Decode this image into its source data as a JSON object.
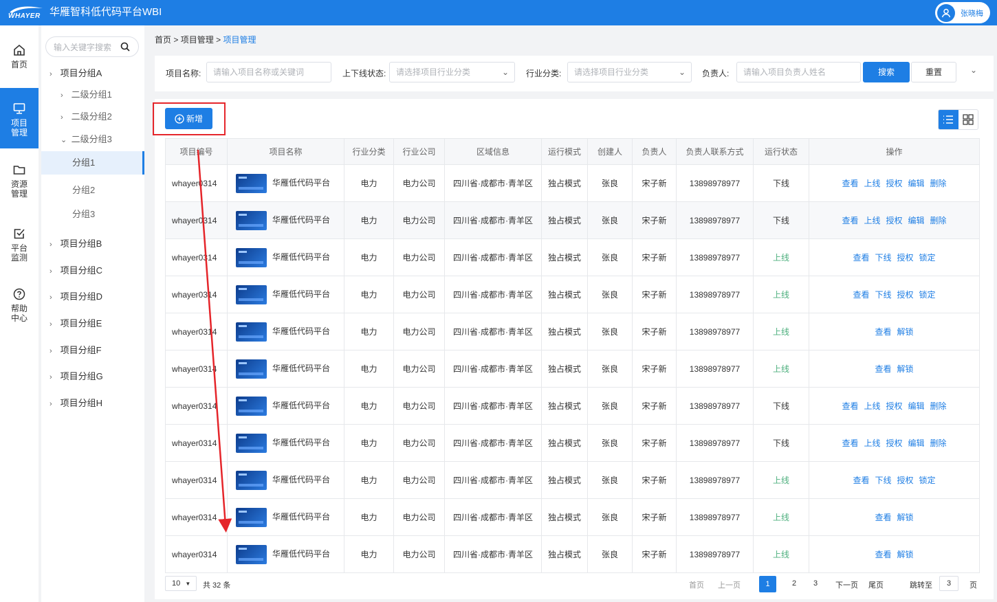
{
  "header": {
    "logo_text": "WHAYER",
    "title": "华雁智科低代码平台WBI",
    "user_name": "张晓梅"
  },
  "rail": [
    {
      "label": "首页",
      "icon": "home-icon"
    },
    {
      "label": "项目\n管理",
      "icon": "monitor-icon",
      "active": true
    },
    {
      "label": "资源\n管理",
      "icon": "folder-icon"
    },
    {
      "label": "平台\n监测",
      "icon": "check-square-icon"
    },
    {
      "label": "帮助\n中心",
      "icon": "help-circle-icon"
    }
  ],
  "tree": {
    "search_placeholder": "输入关键字搜索",
    "nodes": [
      "项目分组A",
      "二级分组1",
      "二级分组2",
      "二级分组3",
      "分组1",
      "分组2",
      "分组3",
      "项目分组B",
      "项目分组C",
      "项目分组D",
      "项目分组E",
      "项目分组F",
      "项目分组G",
      "项目分组H"
    ]
  },
  "breadcrumb": {
    "home": "首页",
    "sep": ">",
    "level1": "项目管理",
    "current": "项目管理"
  },
  "filters": {
    "name_label": "项目名称:",
    "name_placeholder": "请输入项目名称或关键词",
    "status_label": "上下线状态:",
    "status_placeholder": "请选择项目行业分类",
    "industry_label": "行业分类:",
    "industry_placeholder": "请选择项目行业分类",
    "owner_label": "负责人:",
    "owner_placeholder": "请输入项目负责人姓名",
    "search_button": "搜索",
    "reset_button": "重置"
  },
  "toolbar": {
    "add_button": "新增"
  },
  "table": {
    "headers": [
      "项目编号",
      "项目名称",
      "行业分类",
      "行业公司",
      "区域信息",
      "运行模式",
      "创建人",
      "负责人",
      "负责人联系方式",
      "运行状态",
      "操作"
    ],
    "rows": [
      {
        "code": "whayer0314",
        "name": "华雁低代码平台",
        "industry": "电力",
        "company": "电力公司",
        "region": "四川省·成都市·青羊区",
        "mode": "独占模式",
        "creator": "张良",
        "owner": "宋子新",
        "phone": "13898978977",
        "status": "下线",
        "online": false,
        "ops": [
          "查看",
          "上线",
          "授权",
          "编辑",
          "删除"
        ]
      },
      {
        "code": "whayer0314",
        "name": "华雁低代码平台",
        "industry": "电力",
        "company": "电力公司",
        "region": "四川省·成都市·青羊区",
        "mode": "独占模式",
        "creator": "张良",
        "owner": "宋子新",
        "phone": "13898978977",
        "status": "下线",
        "online": false,
        "ops": [
          "查看",
          "上线",
          "授权",
          "编辑",
          "删除"
        ]
      },
      {
        "code": "whayer0314",
        "name": "华雁低代码平台",
        "industry": "电力",
        "company": "电力公司",
        "region": "四川省·成都市·青羊区",
        "mode": "独占模式",
        "creator": "张良",
        "owner": "宋子新",
        "phone": "13898978977",
        "status": "上线",
        "online": true,
        "ops": [
          "查看",
          "下线",
          "授权",
          "锁定"
        ]
      },
      {
        "code": "whayer0314",
        "name": "华雁低代码平台",
        "industry": "电力",
        "company": "电力公司",
        "region": "四川省·成都市·青羊区",
        "mode": "独占模式",
        "creator": "张良",
        "owner": "宋子新",
        "phone": "13898978977",
        "status": "上线",
        "online": true,
        "ops": [
          "查看",
          "下线",
          "授权",
          "锁定"
        ]
      },
      {
        "code": "whayer0314",
        "name": "华雁低代码平台",
        "industry": "电力",
        "company": "电力公司",
        "region": "四川省·成都市·青羊区",
        "mode": "独占模式",
        "creator": "张良",
        "owner": "宋子新",
        "phone": "13898978977",
        "status": "上线",
        "online": true,
        "ops": [
          "查看",
          "解锁"
        ]
      },
      {
        "code": "whayer0314",
        "name": "华雁低代码平台",
        "industry": "电力",
        "company": "电力公司",
        "region": "四川省·成都市·青羊区",
        "mode": "独占模式",
        "creator": "张良",
        "owner": "宋子新",
        "phone": "13898978977",
        "status": "上线",
        "online": true,
        "ops": [
          "查看",
          "解锁"
        ]
      },
      {
        "code": "whayer0314",
        "name": "华雁低代码平台",
        "industry": "电力",
        "company": "电力公司",
        "region": "四川省·成都市·青羊区",
        "mode": "独占模式",
        "creator": "张良",
        "owner": "宋子新",
        "phone": "13898978977",
        "status": "下线",
        "online": false,
        "ops": [
          "查看",
          "上线",
          "授权",
          "编辑",
          "删除"
        ]
      },
      {
        "code": "whayer0314",
        "name": "华雁低代码平台",
        "industry": "电力",
        "company": "电力公司",
        "region": "四川省·成都市·青羊区",
        "mode": "独占模式",
        "creator": "张良",
        "owner": "宋子新",
        "phone": "13898978977",
        "status": "下线",
        "online": false,
        "ops": [
          "查看",
          "上线",
          "授权",
          "编辑",
          "删除"
        ]
      },
      {
        "code": "whayer0314",
        "name": "华雁低代码平台",
        "industry": "电力",
        "company": "电力公司",
        "region": "四川省·成都市·青羊区",
        "mode": "独占模式",
        "creator": "张良",
        "owner": "宋子新",
        "phone": "13898978977",
        "status": "上线",
        "online": true,
        "ops": [
          "查看",
          "下线",
          "授权",
          "锁定"
        ]
      },
      {
        "code": "whayer0314",
        "name": "华雁低代码平台",
        "industry": "电力",
        "company": "电力公司",
        "region": "四川省·成都市·青羊区",
        "mode": "独占模式",
        "creator": "张良",
        "owner": "宋子新",
        "phone": "13898978977",
        "status": "上线",
        "online": true,
        "ops": [
          "查看",
          "解锁"
        ]
      },
      {
        "code": "whayer0314",
        "name": "华雁低代码平台",
        "industry": "电力",
        "company": "电力公司",
        "region": "四川省·成都市·青羊区",
        "mode": "独占模式",
        "creator": "张良",
        "owner": "宋子新",
        "phone": "13898978977",
        "status": "上线",
        "online": true,
        "ops": [
          "查看",
          "解锁"
        ]
      }
    ]
  },
  "pagination": {
    "page_size": "10",
    "total": "共 32 条",
    "first": "首页",
    "prev": "上一页",
    "pages": [
      "1",
      "2",
      "3"
    ],
    "current": "1",
    "next": "下一页",
    "last": "尾页",
    "jump_label": "跳转至",
    "jump_value": "3",
    "page_unit": "页"
  },
  "colors": {
    "primary": "#1e7ee4",
    "online": "#4caf7d",
    "annotation": "#e5252a"
  }
}
